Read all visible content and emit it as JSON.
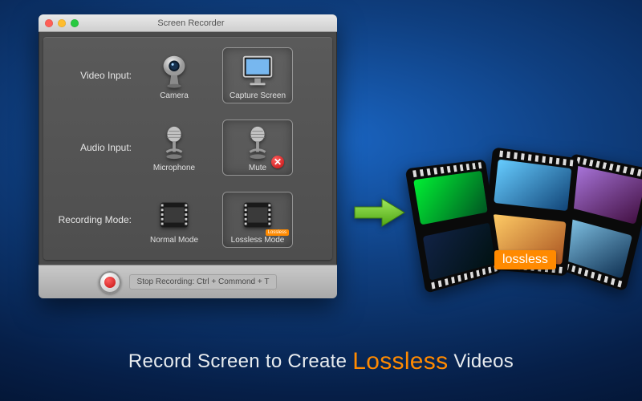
{
  "window": {
    "title": "Screen Recorder"
  },
  "rows": {
    "video": {
      "label": "Video Input:",
      "camera": "Camera",
      "capture": "Capture Screen"
    },
    "audio": {
      "label": "Audio Input:",
      "microphone": "Microphone",
      "mute": "Mute"
    },
    "mode": {
      "label": "Recording Mode:",
      "normal": "Normal Mode",
      "lossless": "Lossless Mode",
      "lossless_tag": "Lossless"
    }
  },
  "footer": {
    "hint": "Stop Recording: Ctrl + Commond + T"
  },
  "badge": "lossless",
  "tagline": {
    "pre": "Record Screen to Create ",
    "hl": "Lossless",
    "post": " Videos"
  },
  "colors": {
    "accent": "#ff8a00",
    "arrow": "#6fce2b"
  }
}
